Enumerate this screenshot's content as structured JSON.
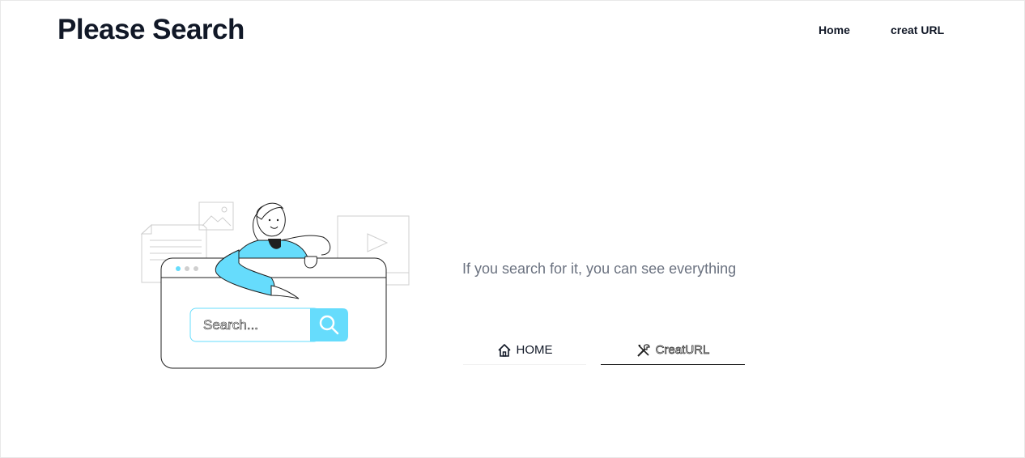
{
  "header": {
    "brand": "Please Search",
    "nav": [
      {
        "label": "Home"
      },
      {
        "label": "creat URL"
      }
    ]
  },
  "illustration": {
    "search_placeholder": "Search...",
    "accent": "#66dcfc"
  },
  "hero": {
    "tagline": "If you search for it, you can see everything",
    "buttons": {
      "home": {
        "label": "HOME",
        "icon": "home-icon"
      },
      "create": {
        "label": "CreatURL",
        "icon": "tools-icon"
      }
    }
  }
}
